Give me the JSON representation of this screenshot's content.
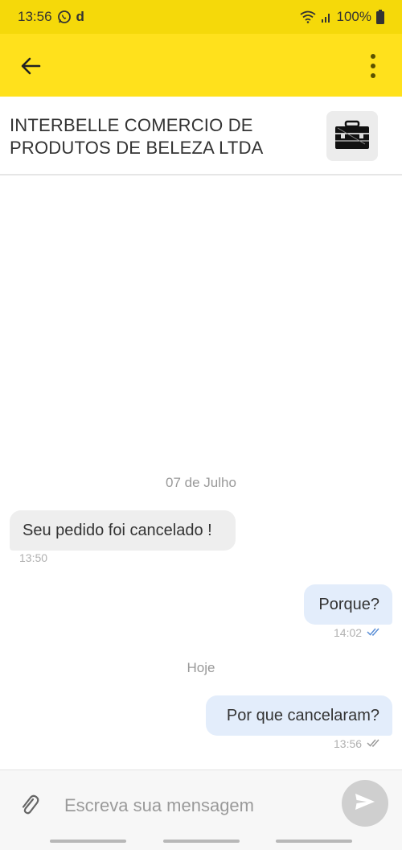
{
  "status_bar": {
    "time": "13:56",
    "notif_letter": "d",
    "battery": "100%"
  },
  "header": {
    "contact_name": "INTERBELLE COMERCIO DE PRODUTOS DE BELEZA LTDA"
  },
  "icons": [
    "whatsapp-icon",
    "wifi-icon",
    "signal-icon",
    "battery-icon",
    "back-arrow-icon",
    "more-vert-icon",
    "store-image",
    "double-check-icon",
    "paperclip-icon",
    "send-icon"
  ],
  "colors": {
    "status_bar": "#f5d90a",
    "app_bar": "#ffe11c",
    "incoming_bubble": "#eeeeee",
    "outgoing_bubble": "#e3edfb",
    "read_check": "#5b8fd6",
    "sent_check": "#9a9a9a"
  },
  "chat": {
    "separators": [
      "07 de Julho",
      "Hoje"
    ],
    "messages": [
      {
        "direction": "in",
        "text": "Seu pedido foi cancelado !",
        "time": "13:50"
      },
      {
        "direction": "out",
        "text": "Porque?",
        "time": "14:02",
        "status": "read"
      },
      {
        "direction": "out",
        "text": "Por que cancelaram?",
        "time": "13:56",
        "status": "sent"
      }
    ]
  },
  "composer": {
    "placeholder": "Escreva sua mensagem"
  }
}
